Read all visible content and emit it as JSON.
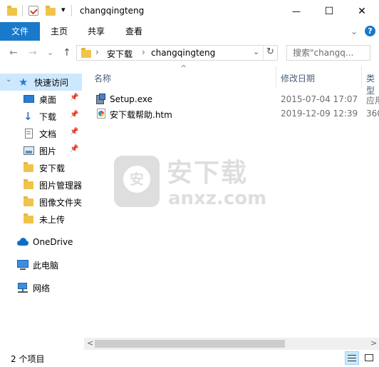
{
  "window": {
    "title": "changqingteng",
    "minimize_glyph": "—",
    "maximize_glyph": "☐",
    "close_glyph": "✕"
  },
  "quick_toolbar": {
    "dropdown_glyph": "▾"
  },
  "ribbon": {
    "tabs": [
      "文件",
      "主页",
      "共享",
      "查看"
    ],
    "expand_glyph": "⌄",
    "help_glyph": "?"
  },
  "nav": {
    "back_glyph": "←",
    "forward_glyph": "→",
    "dropdown_glyph": "⌄",
    "up_glyph": "↑"
  },
  "address": {
    "breadcrumb": [
      "安下载",
      "changqingteng"
    ],
    "separator": "›",
    "dropdown_glyph": "⌄",
    "refresh_glyph": "↻"
  },
  "search": {
    "placeholder": "搜索\"changq..."
  },
  "navpane": {
    "quick_access": "快速访问",
    "items": [
      {
        "label": "桌面",
        "pinned": true
      },
      {
        "label": "下载",
        "pinned": true
      },
      {
        "label": "文档",
        "pinned": true
      },
      {
        "label": "图片",
        "pinned": true
      },
      {
        "label": "安下载",
        "pinned": false
      },
      {
        "label": "图片管理器",
        "pinned": false
      },
      {
        "label": "图像文件夹",
        "pinned": false
      },
      {
        "label": "未上传",
        "pinned": false
      }
    ],
    "onedrive": "OneDrive",
    "this_pc": "此电脑",
    "network": "网络",
    "pin_glyph": "📌"
  },
  "columns": {
    "name": "名称",
    "modified": "修改日期",
    "type": "类型",
    "sort_glyph": "^"
  },
  "files": [
    {
      "name": "Setup.exe",
      "modified": "2015-07-04 17:07",
      "type": "应用"
    },
    {
      "name": "安下载帮助.htm",
      "modified": "2019-12-09 12:39",
      "type": "360"
    }
  ],
  "scrollbar": {
    "left_glyph": "<",
    "right_glyph": ">"
  },
  "status": {
    "item_count": "2 个项目"
  },
  "watermark": {
    "badge": "安",
    "cn": "安下载",
    "en": "anxz.com"
  },
  "colors": {
    "file_tab": "#1979ca",
    "folder": "#f0c34a",
    "selected": "#cce8ff",
    "header_text": "#4c607a"
  }
}
